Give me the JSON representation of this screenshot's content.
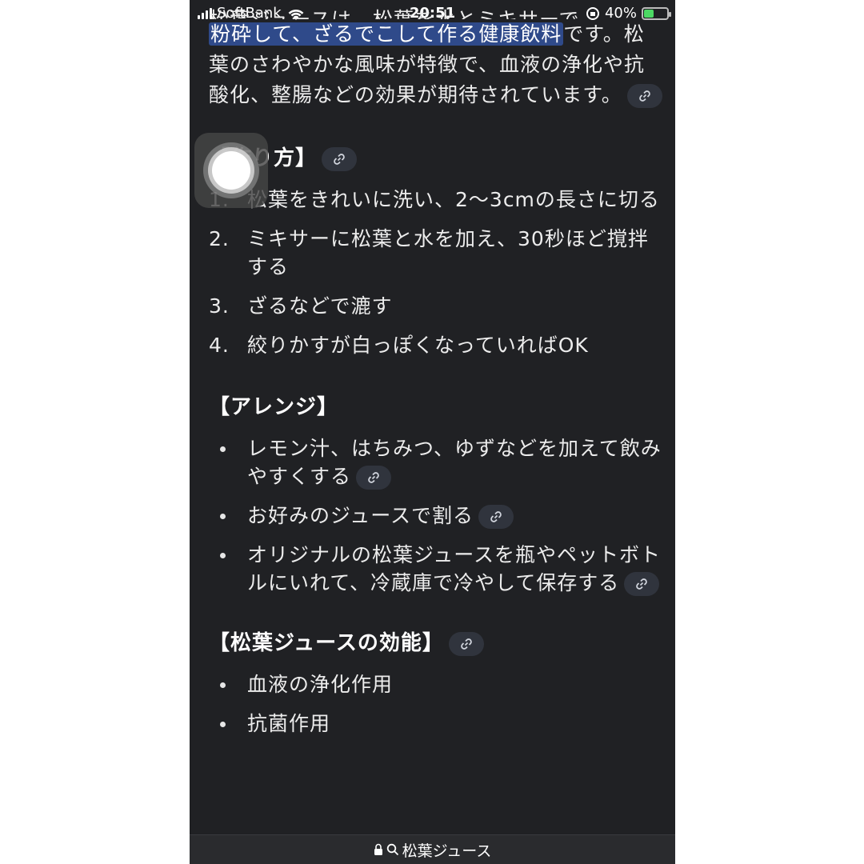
{
  "status_bar": {
    "carrier": "SoftBank",
    "time": "20:51",
    "battery": "40%"
  },
  "intro": {
    "cut_line": "松葉ジュースは、松葉を水とミキサーで",
    "highlight": "粉砕して、ざるでこして作る健康飲料",
    "rest": "です。松葉のさわやかな風味が特徴で、血液の浄化や抗酸化、整腸などの効果が期待されています。"
  },
  "how_to": {
    "heading": "【作り方】",
    "steps": [
      {
        "num": "1.",
        "text": "松葉をきれいに洗い、2〜3cmの長さに切る"
      },
      {
        "num": "2.",
        "text": "ミキサーに松葉と水を加え、30秒ほど撹拌する"
      },
      {
        "num": "3.",
        "text": "ざるなどで漉す"
      },
      {
        "num": "4.",
        "text": "絞りかすが白っぽくなっていればOK"
      }
    ]
  },
  "arrange": {
    "heading": "【アレンジ】",
    "items": [
      "レモン汁、はちみつ、ゆずなどを加えて飲みやすくする",
      "お好みのジュースで割る",
      "オリジナルの松葉ジュースを瓶やペットボトルにいれて、冷蔵庫で冷やして保存する"
    ]
  },
  "benefits": {
    "heading": "【松葉ジュースの効能】",
    "items": [
      "血液の浄化作用",
      "抗菌作用"
    ]
  },
  "address_bar": {
    "query": "松葉ジュース"
  },
  "colors": {
    "background": "#202124",
    "highlight": "#2f4a8a",
    "link_chip": "#30343d"
  }
}
